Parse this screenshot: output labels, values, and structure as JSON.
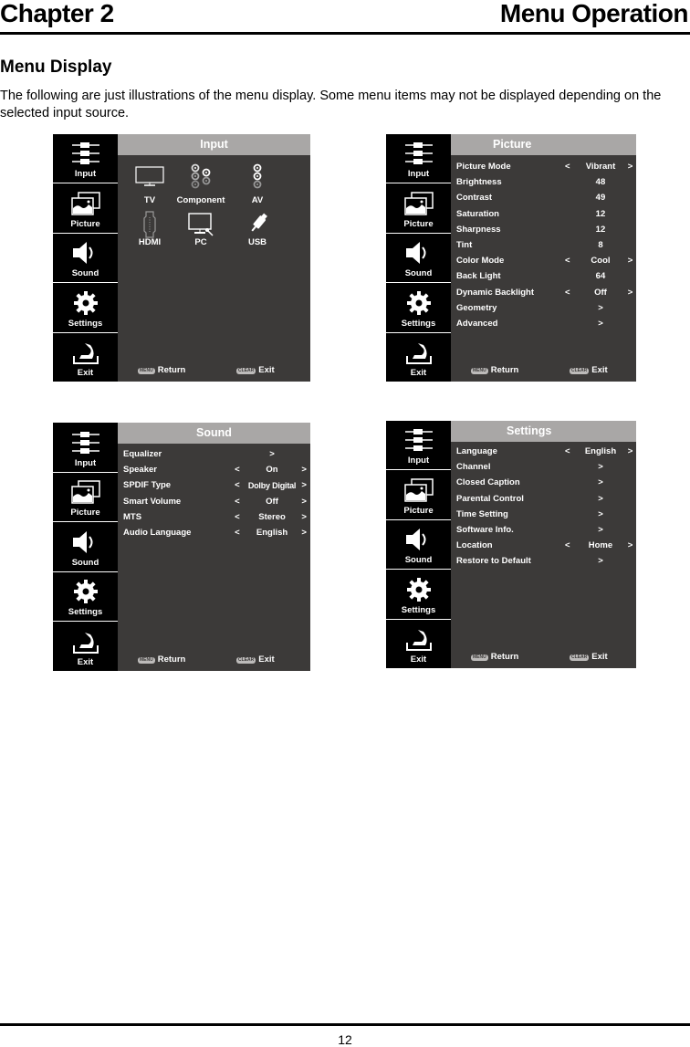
{
  "page": {
    "chapter": "Chapter 2",
    "section": "Menu Operation",
    "heading": "Menu Display",
    "intro": "The following are just illustrations of the menu display. Some menu items may not be displayed depending on the selected input source.",
    "page_number": "12"
  },
  "sidebar": {
    "items": [
      {
        "label": "Input",
        "icon": "input-cables-icon"
      },
      {
        "label": "Picture",
        "icon": "picture-icon"
      },
      {
        "label": "Sound",
        "icon": "speaker-icon"
      },
      {
        "label": "Settings",
        "icon": "gear-icon"
      },
      {
        "label": "Exit",
        "icon": "exit-arrow-icon"
      }
    ]
  },
  "footer": {
    "menu_key": "MENU",
    "return_label": "Return",
    "clear_key": "CLEAR",
    "exit_label": "Exit"
  },
  "menus": {
    "input": {
      "title": "Input",
      "sources": [
        {
          "label": "TV",
          "icon": "tv-icon"
        },
        {
          "label": "Component",
          "icon": "component-icon"
        },
        {
          "label": "AV",
          "icon": "av-icon"
        },
        {
          "label": "HDMI",
          "icon": "hdmi-icon"
        },
        {
          "label": "PC",
          "icon": "pc-icon"
        },
        {
          "label": "USB",
          "icon": "usb-icon"
        }
      ]
    },
    "picture": {
      "title": "Picture",
      "rows": [
        {
          "label": "Picture Mode",
          "left": "<",
          "value": "Vibrant",
          "right": ">"
        },
        {
          "label": "Brightness",
          "left": "",
          "value": "48",
          "right": ""
        },
        {
          "label": "Contrast",
          "left": "",
          "value": "49",
          "right": ""
        },
        {
          "label": "Saturation",
          "left": "",
          "value": "12",
          "right": ""
        },
        {
          "label": "Sharpness",
          "left": "",
          "value": "12",
          "right": ""
        },
        {
          "label": "Tint",
          "left": "",
          "value": "8",
          "right": ""
        },
        {
          "label": "Color Mode",
          "left": "<",
          "value": "Cool",
          "right": ">"
        },
        {
          "label": "Back Light",
          "left": "",
          "value": "64",
          "right": ""
        },
        {
          "label": "Dynamic Backlight",
          "left": "<",
          "value": "Off",
          "right": ">"
        },
        {
          "label": "Geometry",
          "left": "",
          "value": ">",
          "right": ""
        },
        {
          "label": "Advanced",
          "left": "",
          "value": ">",
          "right": ""
        }
      ]
    },
    "sound": {
      "title": "Sound",
      "rows": [
        {
          "label": "Equalizer",
          "left": "",
          "value": ">",
          "right": ""
        },
        {
          "label": "Speaker",
          "left": "<",
          "value": "On",
          "right": ">"
        },
        {
          "label": "SPDIF Type",
          "left": "<",
          "value": "Dolby Digital",
          "right": ">"
        },
        {
          "label": "Smart Volume",
          "left": "<",
          "value": "Off",
          "right": ">"
        },
        {
          "label": "MTS",
          "left": "<",
          "value": "Stereo",
          "right": ">"
        },
        {
          "label": "Audio Language",
          "left": "<",
          "value": "English",
          "right": ">"
        }
      ]
    },
    "settings": {
      "title": "Settings",
      "rows": [
        {
          "label": "Language",
          "left": "<",
          "value": "English",
          "right": ">"
        },
        {
          "label": "Channel",
          "left": "",
          "value": ">",
          "right": ""
        },
        {
          "label": "Closed Caption",
          "left": "",
          "value": ">",
          "right": ""
        },
        {
          "label": "Parental Control",
          "left": "",
          "value": ">",
          "right": ""
        },
        {
          "label": "Time Setting",
          "left": "",
          "value": ">",
          "right": ""
        },
        {
          "label": "Software Info.",
          "left": "",
          "value": ">",
          "right": ""
        },
        {
          "label": "Location",
          "left": "<",
          "value": "Home",
          "right": ">"
        },
        {
          "label": "Restore to Default",
          "left": "",
          "value": ">",
          "right": ""
        }
      ]
    }
  }
}
